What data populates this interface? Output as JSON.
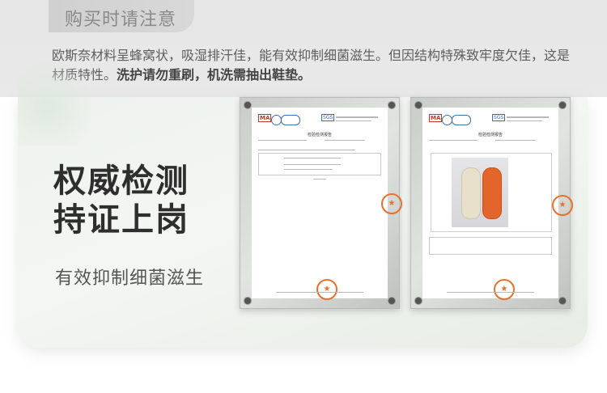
{
  "notice": {
    "title": "购买时请注意",
    "text_normal": "欧斯奈材料呈蜂窝状，吸湿排汗佳，能有效抑制细菌滋生。但因结构特殊致牢度欠佳，这是材质特性。",
    "text_bold": "洗护请勿重刷，机洗需抽出鞋垫。"
  },
  "hero": {
    "headline_line1": "权威检测",
    "headline_line2": "持证上岗",
    "subline": "有效抑制细菌滋生"
  },
  "colors": {
    "accent": "#e3652b",
    "stamp": "#e8702a",
    "text_dark": "#2e2e2e"
  },
  "certificates": {
    "cert1_title": "检验检测报告",
    "cert2_title": "检验检测报告",
    "logo_ma": "MA",
    "logo_sgs": "SGS"
  }
}
